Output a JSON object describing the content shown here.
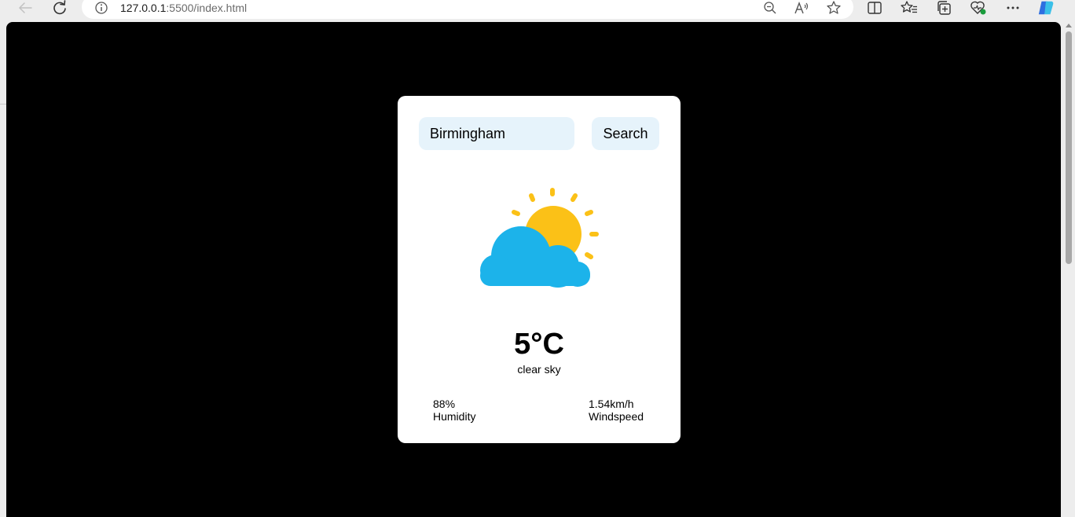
{
  "browser": {
    "url_host": "127.0.0.1",
    "url_rest": ":5500/index.html"
  },
  "weather": {
    "search": {
      "value": "Birmingham",
      "button_label": "Search"
    },
    "icon": "partly-cloudy-icon",
    "temperature": "5°C",
    "description": "clear sky",
    "humidity": {
      "value": "88%",
      "label": "Humidity"
    },
    "windspeed": {
      "value": "1.54km/h",
      "label": "Windspeed"
    }
  },
  "colors": {
    "page_background": "#000000",
    "card_background": "#ffffff",
    "input_background": "#e6f3fb",
    "sun": "#fbc117",
    "cloud": "#1cb3ea"
  }
}
